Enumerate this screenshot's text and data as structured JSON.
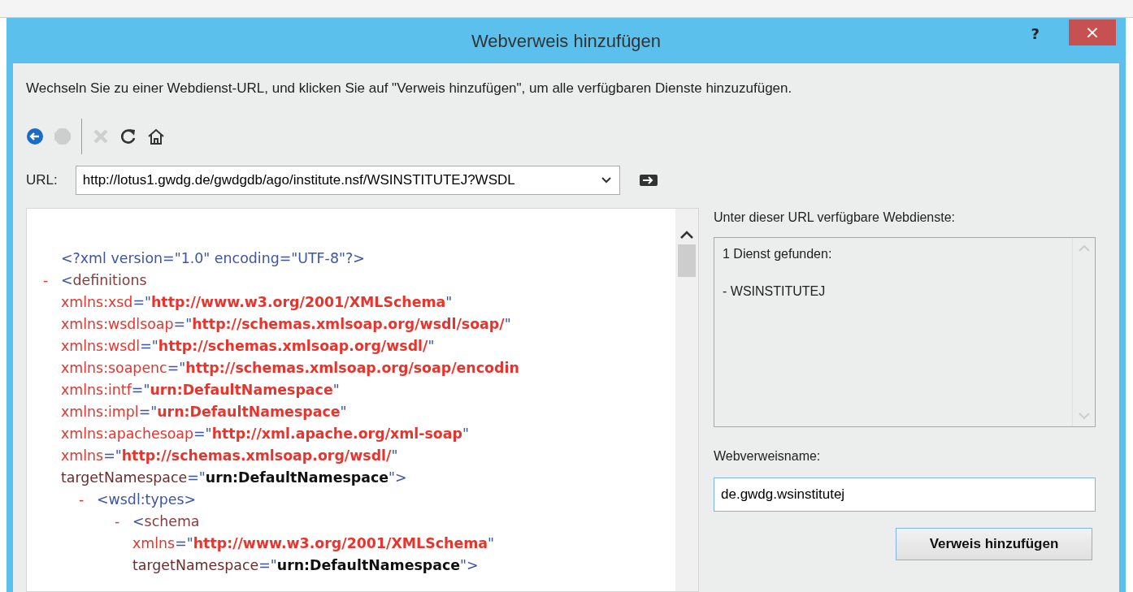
{
  "window": {
    "title": "Webverweis hinzufügen",
    "help": "?",
    "close": "×"
  },
  "instruction": "Wechseln Sie zu einer Webdienst-URL, und klicken Sie auf \"Verweis hinzufügen\", um alle verfügbaren Dienste hinzuzufügen.",
  "toolbar": [
    {
      "kind": "back",
      "disabled": false
    },
    {
      "kind": "stop",
      "disabled": true
    },
    {
      "kind": "separator"
    },
    {
      "kind": "delete",
      "disabled": true
    },
    {
      "kind": "refresh",
      "disabled": false
    },
    {
      "kind": "home",
      "disabled": false
    }
  ],
  "url": {
    "label": "URL:",
    "value": "http://lotus1.gwdg.de/gwdgdb/ago/institute.nsf/WSINSTITUTEJ?WSDL"
  },
  "xml": {
    "declaration": [
      {
        "kind": "punct",
        "text": "<?xml version=\"1.0\" encoding=\"UTF-8\"?>"
      }
    ],
    "nodes": [
      {
        "marker": "-",
        "lines": [
          [
            {
              "kind": "punct",
              "text": "<"
            },
            {
              "kind": "tag",
              "text": "definitions"
            }
          ],
          [
            {
              "kind": "attr",
              "text": "xmlns:xsd"
            },
            {
              "kind": "punct",
              "text": "=\""
            },
            {
              "kind": "value",
              "text": "http://www.w3.org/2001/XMLSchema"
            },
            {
              "kind": "punct",
              "text": "\""
            }
          ],
          [
            {
              "kind": "attr",
              "text": "xmlns:wsdlsoap"
            },
            {
              "kind": "punct",
              "text": "=\""
            },
            {
              "kind": "value",
              "text": "http://schemas.xmlsoap.org/wsdl/soap/"
            },
            {
              "kind": "punct",
              "text": "\""
            }
          ],
          [
            {
              "kind": "attr",
              "text": "xmlns:wsdl"
            },
            {
              "kind": "punct",
              "text": "=\""
            },
            {
              "kind": "value",
              "text": "http://schemas.xmlsoap.org/wsdl/"
            },
            {
              "kind": "punct",
              "text": "\""
            }
          ],
          [
            {
              "kind": "attr",
              "text": "xmlns:soapenc"
            },
            {
              "kind": "punct",
              "text": "=\""
            },
            {
              "kind": "value",
              "text": "http://schemas.xmlsoap.org/soap/encodin"
            }
          ],
          [
            {
              "kind": "attr",
              "text": "xmlns:intf"
            },
            {
              "kind": "punct",
              "text": "=\""
            },
            {
              "kind": "value",
              "text": "urn:DefaultNamespace"
            },
            {
              "kind": "punct",
              "text": "\""
            }
          ],
          [
            {
              "kind": "attr",
              "text": "xmlns:impl"
            },
            {
              "kind": "punct",
              "text": "=\""
            },
            {
              "kind": "value",
              "text": "urn:DefaultNamespace"
            },
            {
              "kind": "punct",
              "text": "\""
            }
          ],
          [
            {
              "kind": "attr",
              "text": "xmlns:apachesoap"
            },
            {
              "kind": "punct",
              "text": "=\""
            },
            {
              "kind": "value",
              "text": "http://xml.apache.org/xml-soap"
            },
            {
              "kind": "punct",
              "text": "\""
            }
          ],
          [
            {
              "kind": "attr",
              "text": "xmlns"
            },
            {
              "kind": "punct",
              "text": "=\""
            },
            {
              "kind": "value",
              "text": "http://schemas.xmlsoap.org/wsdl/"
            },
            {
              "kind": "punct",
              "text": "\""
            }
          ],
          [
            {
              "kind": "name",
              "text": "targetNamespace"
            },
            {
              "kind": "punct",
              "text": "=\""
            },
            {
              "kind": "strong",
              "text": "urn:DefaultNamespace"
            },
            {
              "kind": "punct",
              "text": "\">"
            }
          ]
        ],
        "children": [
          {
            "marker": "-",
            "lines": [
              [
                {
                  "kind": "punct",
                  "text": "<wsdl:types>"
                }
              ]
            ],
            "children": [
              {
                "marker": "-",
                "lines": [
                  [
                    {
                      "kind": "punct",
                      "text": "<"
                    },
                    {
                      "kind": "tag",
                      "text": "schema"
                    }
                  ],
                  [
                    {
                      "kind": "attr",
                      "text": "xmlns"
                    },
                    {
                      "kind": "punct",
                      "text": "=\""
                    },
                    {
                      "kind": "value",
                      "text": "http://www.w3.org/2001/XMLSchema"
                    },
                    {
                      "kind": "punct",
                      "text": "\""
                    }
                  ],
                  [
                    {
                      "kind": "name",
                      "text": "targetNamespace"
                    },
                    {
                      "kind": "punct",
                      "text": "=\""
                    },
                    {
                      "kind": "strong",
                      "text": "urn:DefaultNamespace"
                    },
                    {
                      "kind": "punct",
                      "text": "\">"
                    }
                  ]
                ]
              }
            ]
          }
        ]
      }
    ]
  },
  "services": {
    "label": "Unter dieser URL verfügbare Webdienste:",
    "lines": [
      "1 Dienst gefunden:",
      "- WSINSTITUTEJ"
    ]
  },
  "reference_name": {
    "label": "Webverweisname:",
    "value": "de.gwdg.wsinstitutej"
  },
  "add_button": "Verweis hinzufügen"
}
